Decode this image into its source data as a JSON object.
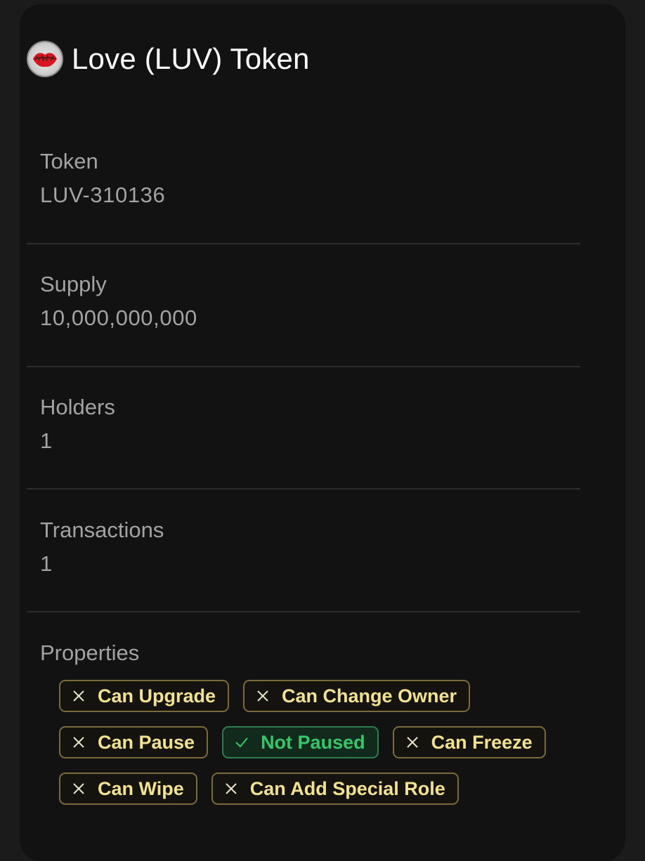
{
  "header": {
    "title": "Love (LUV) Token",
    "logo_icon": "lips-kiss-logo-icon"
  },
  "details": [
    {
      "label": "Token",
      "value": "LUV-310136"
    },
    {
      "label": "Supply",
      "value": "10,000,000,000"
    },
    {
      "label": "Holders",
      "value": "1"
    },
    {
      "label": "Transactions",
      "value": "1"
    }
  ],
  "properties": {
    "label": "Properties",
    "badges": [
      {
        "text": "Can Upgrade",
        "status": "no",
        "icon": "x-icon"
      },
      {
        "text": "Can Change Owner",
        "status": "no",
        "icon": "x-icon"
      },
      {
        "text": "Can Pause",
        "status": "no",
        "icon": "x-icon"
      },
      {
        "text": "Not Paused",
        "status": "yes",
        "icon": "check-icon"
      },
      {
        "text": "Can Freeze",
        "status": "no",
        "icon": "x-icon"
      },
      {
        "text": "Can Wipe",
        "status": "no",
        "icon": "x-icon"
      },
      {
        "text": "Can Add Special Role",
        "status": "no",
        "icon": "x-icon"
      }
    ]
  },
  "colors": {
    "background": "#1b1b1b",
    "card": "#121212",
    "label_text": "#a3a3a3",
    "badge_warning_text": "#f2e28f",
    "badge_warning_border": "#7d6a3a",
    "badge_success_text": "#35c66a",
    "badge_success_border": "#2e7d4f"
  }
}
